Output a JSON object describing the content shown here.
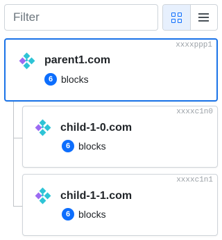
{
  "filter": {
    "placeholder": "Filter",
    "value": ""
  },
  "view_toggle": {
    "options": [
      "grid-icon",
      "list-icon"
    ],
    "selected": "grid-icon"
  },
  "colors": {
    "accent": "#1a73e8",
    "badge": "#0d6efd",
    "logo_teal": "#2ec4d6",
    "logo_purple": "#9b6bf2"
  },
  "nodes": [
    {
      "id": "xxxxppp1",
      "name": "parent1.com",
      "blocks_count": "6",
      "blocks_label": "blocks",
      "selected": true
    },
    {
      "id": "xxxxc1n0",
      "name": "child-1-0.com",
      "blocks_count": "6",
      "blocks_label": "blocks",
      "selected": false
    },
    {
      "id": "xxxxc1n1",
      "name": "child-1-1.com",
      "blocks_count": "6",
      "blocks_label": "blocks",
      "selected": false
    }
  ]
}
